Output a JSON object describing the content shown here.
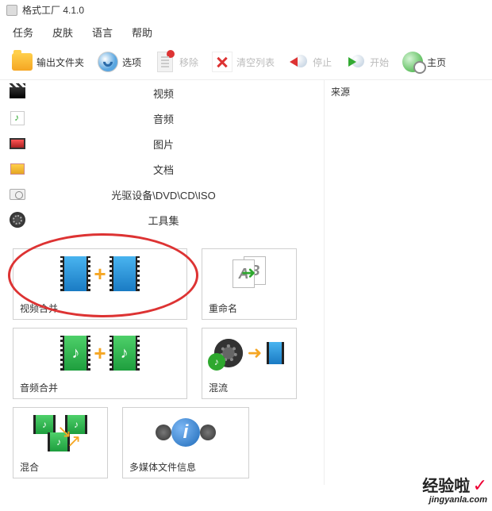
{
  "window": {
    "title": "格式工厂 4.1.0"
  },
  "menu": {
    "task": "任务",
    "skin": "皮肤",
    "language": "语言",
    "help": "帮助"
  },
  "toolbar": {
    "output_folder": "输出文件夹",
    "options": "选项",
    "remove": "移除",
    "clear_list": "清空列表",
    "stop": "停止",
    "start": "开始",
    "home": "主页"
  },
  "categories": {
    "video": "视频",
    "audio": "音频",
    "picture": "图片",
    "document": "文档",
    "drive": "光驱设备\\DVD\\CD\\ISO",
    "tools": "工具集"
  },
  "tools": {
    "video_merge": "视频合并",
    "rename": "重命名",
    "audio_merge": "音频合并",
    "mux": "混流",
    "mix": "混合",
    "media_info": "多媒体文件信息"
  },
  "right_panel": {
    "source": "来源"
  },
  "watermark": {
    "cn": "经验啦",
    "url": "jingyanla.com"
  }
}
